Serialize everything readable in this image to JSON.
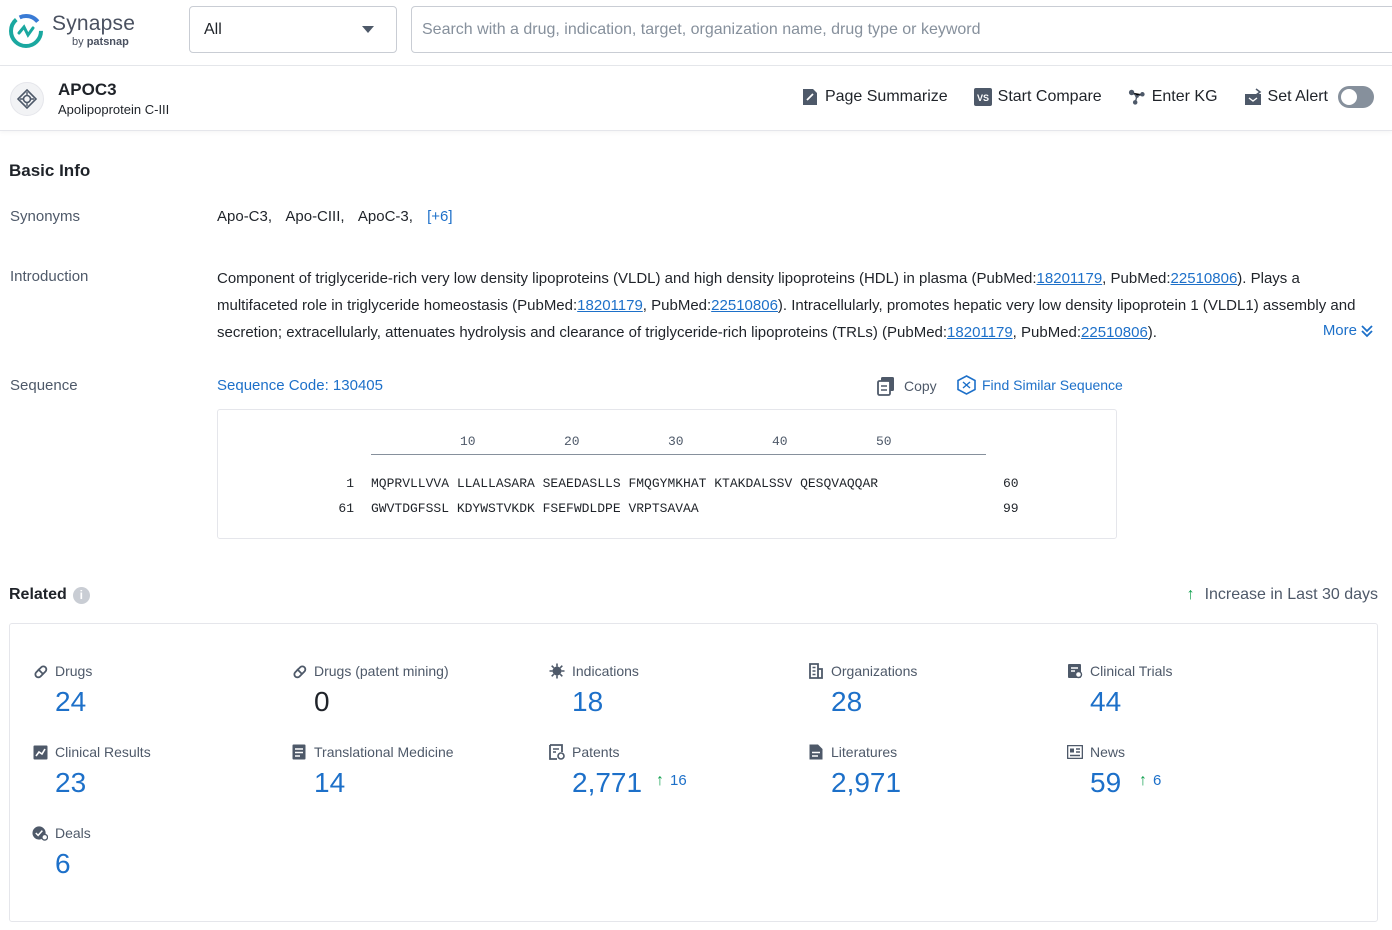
{
  "header": {
    "logo_name": "Synapse",
    "logo_by": "by",
    "logo_brand": "patsnap",
    "scope_select": "All",
    "search_placeholder": "Search with a drug, indication, target, organization name, drug type or keyword"
  },
  "entity": {
    "name": "APOC3",
    "full_name": "Apolipoprotein C-III",
    "actions": {
      "summarize": "Page Summarize",
      "compare": "Start Compare",
      "kg": "Enter KG",
      "alert": "Set Alert"
    },
    "alert_enabled": false
  },
  "basic_info": {
    "title": "Basic Info",
    "synonyms_label": "Synonyms",
    "synonyms": [
      "Apo-C3,",
      "Apo-CIII,",
      "ApoC-3,"
    ],
    "synonyms_more": "[+6]",
    "intro_label": "Introduction",
    "intro_parts": {
      "p1": "Component of triglyceride-rich very low density lipoproteins (VLDL) and high density lipoproteins (HDL) in plasma (PubMed:",
      "l1": "18201179",
      "p2": ", PubMed:",
      "l2": "22510806",
      "p3": "). Plays a multifaceted role in triglyceride homeostasis (PubMed:",
      "l3": "18201179",
      "p4": ", PubMed:",
      "l4": "22510806",
      "p5": "). Intracellularly, promotes hepatic very low density lipoprotein 1 (VLDL1) assembly and secretion; extracellularly, attenuates hydrolysis and clearance of triglyceride-rich lipoproteins (TRLs) (PubMed:",
      "l5": "18201179",
      "p6": ", PubMed:",
      "l6": "22510806",
      "p7": ")."
    },
    "intro_more": "More",
    "sequence_label": "Sequence",
    "sequence_code": "Sequence Code: 130405",
    "copy": "Copy",
    "find_similar": "Find Similar Sequence",
    "ruler_ticks": [
      "10",
      "20",
      "30",
      "40",
      "50"
    ],
    "rows": [
      {
        "start": "1",
        "seq": "MQPRVLLVVA LLALLASARA SEAEDASLLS FMQGYMKHAT KTAKDALSSV QESQVAQQAR",
        "end": "60"
      },
      {
        "start": "61",
        "seq": "GWVTDGFSSL KDYWSTVKDK FSEFWDLDPE VRPTSAVAA",
        "end": "99"
      }
    ]
  },
  "related": {
    "title": "Related",
    "info_icon": "i",
    "legend_arrow": "↑",
    "legend": "Increase in Last 30 days",
    "stats": [
      {
        "label": "Drugs",
        "value": "24",
        "icon": "pill-icon"
      },
      {
        "label": "Drugs (patent mining)",
        "value": "0",
        "icon": "pill-icon"
      },
      {
        "label": "Indications",
        "value": "18",
        "icon": "virus-icon"
      },
      {
        "label": "Organizations",
        "value": "28",
        "icon": "building-icon"
      },
      {
        "label": "Clinical Trials",
        "value": "44",
        "icon": "clipboard-icon"
      },
      {
        "label": "Clinical Results",
        "value": "23",
        "icon": "chart-doc-icon"
      },
      {
        "label": "Translational Medicine",
        "value": "14",
        "icon": "doc-icon"
      },
      {
        "label": "Patents",
        "value": "2,771",
        "icon": "patent-icon",
        "increase_arrow": "↑",
        "increase": "16"
      },
      {
        "label": "Literatures",
        "value": "2,971",
        "icon": "book-icon"
      },
      {
        "label": "News",
        "value": "59",
        "icon": "news-icon",
        "increase_arrow": "↑",
        "increase": "6"
      },
      {
        "label": "Deals",
        "value": "6",
        "icon": "handshake-icon"
      }
    ]
  },
  "colors": {
    "link": "#1d70c9",
    "increase": "#12a150",
    "logo_teal": "#1aa8a0"
  }
}
